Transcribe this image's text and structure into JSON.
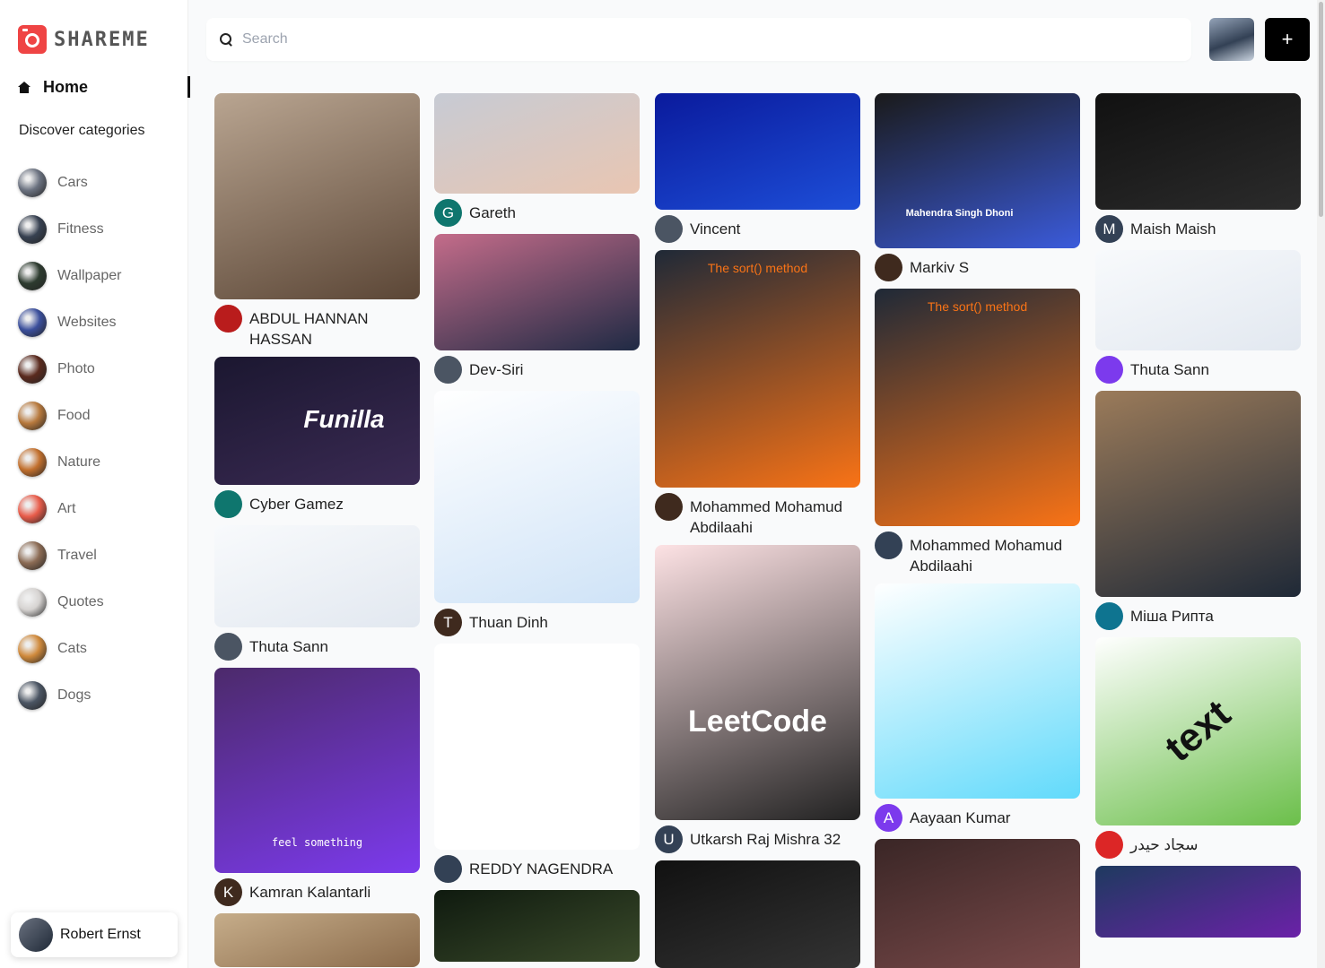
{
  "app": {
    "name": "SHAREME"
  },
  "sidebar": {
    "home_label": "Home",
    "discover_label": "Discover categories",
    "categories": [
      {
        "label": "Cars",
        "color": "#6b7280"
      },
      {
        "label": "Fitness",
        "color": "#374151"
      },
      {
        "label": "Wallpaper",
        "color": "#2d3b2f"
      },
      {
        "label": "Websites",
        "color": "#3b4f9c"
      },
      {
        "label": "Photo",
        "color": "#5a2a1e"
      },
      {
        "label": "Food",
        "color": "#b7793d"
      },
      {
        "label": "Nature",
        "color": "#c2702e"
      },
      {
        "label": "Art",
        "color": "#e85c4a"
      },
      {
        "label": "Travel",
        "color": "#8b6b54"
      },
      {
        "label": "Quotes",
        "color": "#d6d3d1"
      },
      {
        "label": "Cats",
        "color": "#d08a3c"
      },
      {
        "label": "Dogs",
        "color": "#4b5563"
      }
    ],
    "user_name": "Robert Ernst"
  },
  "search": {
    "placeholder": "Search",
    "value": ""
  },
  "header": {
    "add_label": "+"
  },
  "pins": {
    "c1": [
      {
        "user": "ABDUL HANNAN HASSAN",
        "img_height": 230,
        "colors": [
          "#b9a591",
          "#5b4636"
        ]
      },
      {
        "user": "Cyber Gamez",
        "img_height": 143,
        "initial": "",
        "text": "Funilla",
        "colors": [
          "#1b1730",
          "#3a2a53"
        ]
      },
      {
        "user": "Thuta Sann",
        "img_height": 114,
        "colors": [
          "#f8fafc",
          "#e2e8f0"
        ]
      },
      {
        "user": "Kamran Kalantarli",
        "img_height": 229,
        "initial": "K",
        "text": "feel something",
        "colors": [
          "#4c2a6b",
          "#7c3aed"
        ]
      },
      {
        "user": "",
        "img_height": 60,
        "colors": [
          "#c6ad8a",
          "#8a6a4a"
        ]
      }
    ],
    "c2": [
      {
        "user": "Gareth",
        "img_height": 112,
        "initial": "G",
        "colors": [
          "#c7cbd4",
          "#e9c6b2"
        ]
      },
      {
        "user": "Dev-Siri",
        "img_height": 130,
        "colors": [
          "#c46c8a",
          "#1f2a44"
        ]
      },
      {
        "user": "Thuan Dinh",
        "img_height": 237,
        "initial": "T",
        "colors": [
          "#ffffff",
          "#cfe3f7"
        ]
      },
      {
        "user": "REDDY NAGENDRA",
        "img_height": 230,
        "colors": [
          "#ffffff",
          "#ffffff"
        ]
      },
      {
        "user": "",
        "img_height": 80,
        "colors": [
          "#0f1a0f",
          "#3a4a2a"
        ]
      }
    ],
    "c3": [
      {
        "user": "Vincent",
        "img_height": 130,
        "colors": [
          "#0a1a9c",
          "#1d4ed8"
        ]
      },
      {
        "user": "Mohammed Mohamud Abdilaahi",
        "img_height": 265,
        "text": "The sort() method",
        "colors": [
          "#1f2937",
          "#f97316"
        ]
      },
      {
        "user": "Utkarsh Raj Mishra 32",
        "img_height": 307,
        "initial": "U",
        "text": "LeetCode",
        "colors": [
          "#fde2e4",
          "#222222"
        ]
      },
      {
        "user": "",
        "img_height": 120,
        "colors": [
          "#111111",
          "#333333"
        ]
      }
    ],
    "c4": [
      {
        "user": "Markiv S",
        "img_height": 173,
        "text": "Mahendra Singh Dhoni",
        "colors": [
          "#1a1a1a",
          "#3b5bdb"
        ]
      },
      {
        "user": "Mohammed Mohamud Abdilaahi",
        "img_height": 265,
        "text": "The sort() method",
        "colors": [
          "#1f2937",
          "#f97316"
        ]
      },
      {
        "user": "Aayaan Kumar",
        "img_height": 240,
        "initial": "A",
        "colors": [
          "#ffffff",
          "#61dafb"
        ]
      },
      {
        "user": "",
        "img_height": 150,
        "colors": [
          "#3a2626",
          "#7a4a4a"
        ]
      }
    ],
    "c5": [
      {
        "user": "Maish Maish",
        "img_height": 130,
        "initial": "M",
        "colors": [
          "#111111",
          "#2b2b2b"
        ]
      },
      {
        "user": "Thuta Sann",
        "img_height": 112,
        "colors": [
          "#f8fafc",
          "#e2e8f0"
        ]
      },
      {
        "user": "Міша Рипта",
        "img_height": 230,
        "colors": [
          "#9b7b5a",
          "#1f2937"
        ]
      },
      {
        "user": "سجاد حيدر",
        "img_height": 210,
        "text": "text",
        "colors": [
          "#ffffff",
          "#6bbf4a"
        ]
      },
      {
        "user": "",
        "img_height": 80,
        "colors": [
          "#1e3a5f",
          "#6b21a8"
        ]
      }
    ]
  }
}
